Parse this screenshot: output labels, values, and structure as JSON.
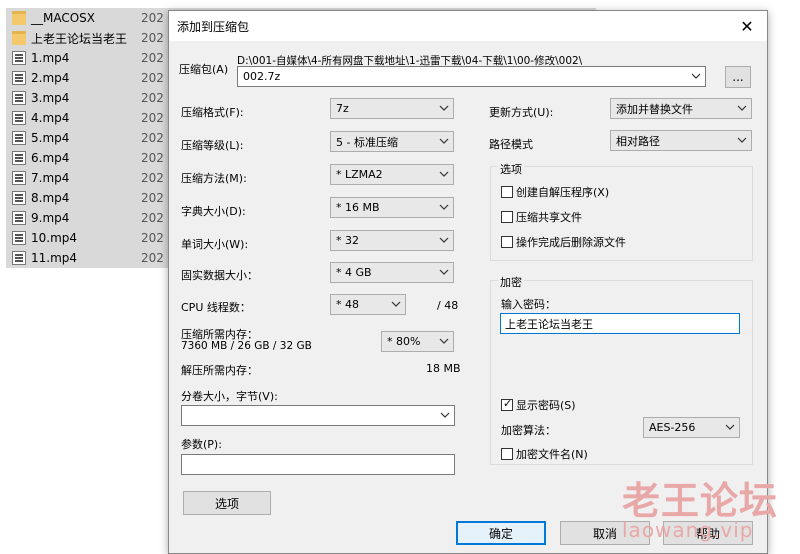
{
  "explorer": {
    "files": [
      {
        "name": "__MACOSX",
        "date": "202",
        "icon": "folder-icon"
      },
      {
        "name": "上老王论坛当老王",
        "date": "202",
        "icon": "folder-icon"
      },
      {
        "name": "1.mp4",
        "date": "202",
        "icon": "video-file-icon"
      },
      {
        "name": "2.mp4",
        "date": "202",
        "icon": "video-file-icon"
      },
      {
        "name": "3.mp4",
        "date": "202",
        "icon": "video-file-icon"
      },
      {
        "name": "4.mp4",
        "date": "202",
        "icon": "video-file-icon"
      },
      {
        "name": "5.mp4",
        "date": "202",
        "icon": "video-file-icon"
      },
      {
        "name": "6.mp4",
        "date": "202",
        "icon": "video-file-icon"
      },
      {
        "name": "7.mp4",
        "date": "202",
        "icon": "video-file-icon"
      },
      {
        "name": "8.mp4",
        "date": "202",
        "icon": "video-file-icon"
      },
      {
        "name": "9.mp4",
        "date": "202",
        "icon": "video-file-icon"
      },
      {
        "name": "10.mp4",
        "date": "202",
        "icon": "video-file-icon"
      },
      {
        "name": "11.mp4",
        "date": "202",
        "icon": "video-file-icon"
      }
    ]
  },
  "dialog": {
    "title": "添加到压缩包",
    "archive_label": "压缩包(A)",
    "archive_path": "D:\\001-自媒体\\4-所有网盘下载地址\\1-迅雷下载\\04-下载\\1\\00-修改\\002\\",
    "archive_name": "002.7z",
    "browse_label": "...",
    "format_label": "压缩格式(F):",
    "format_value": "7z",
    "level_label": "压缩等级(L):",
    "level_value": "5 - 标准压缩",
    "method_label": "压缩方法(M):",
    "method_value": "* LZMA2",
    "dict_label": "字典大小(D):",
    "dict_value": "* 16 MB",
    "word_label": "单词大小(W):",
    "word_value": "* 32",
    "solid_label": "固实数据大小：",
    "solid_value": "* 4 GB",
    "cpu_label": "CPU 线程数：",
    "cpu_value": "* 48",
    "cpu_max": "/ 48",
    "mem_label": "压缩所需内存：",
    "mem_value": "7360 MB / 26 GB / 32 GB",
    "mem_percent": "* 80%",
    "decomp_label": "解压所需内存：",
    "decomp_value": "18 MB",
    "split_label": "分卷大小，字节(V):",
    "split_value": "",
    "params_label": "参数(P):",
    "params_value": "",
    "options_button": "选项",
    "update_label": "更新方式(U):",
    "update_value": "添加并替换文件",
    "path_label": "路径模式",
    "path_value": "相对路径",
    "options_group": "选项",
    "opt_sfx": "创建自解压程序(X)",
    "opt_shared": "压缩共享文件",
    "opt_delete": "操作完成后删除源文件",
    "encrypt_group": "加密",
    "password_label": "输入密码：",
    "password_value": "上老王论坛当老王",
    "show_password": "显示密码(S)",
    "enc_method_label": "加密算法：",
    "enc_method_value": "AES-256",
    "encrypt_names": "加密文件名(N)",
    "ok": "确定",
    "cancel": "取消",
    "help": "帮助"
  },
  "watermark": {
    "text": "老王论坛",
    "url": "laowang.vip",
    "color": "#e9a8a8"
  }
}
